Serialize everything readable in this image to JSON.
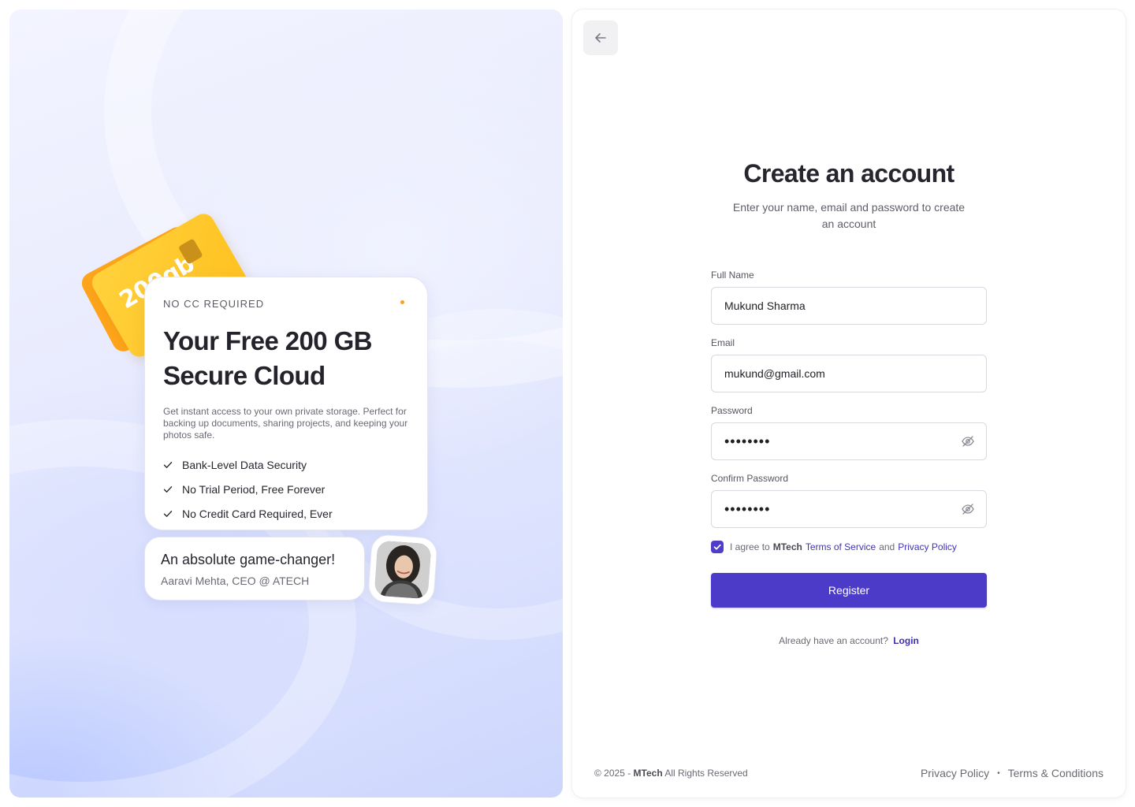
{
  "promo": {
    "storage_badge": "200gb",
    "eyebrow": "NO CC REQUIRED",
    "title_line1": "Your Free 200 GB",
    "title_line2": "Secure Cloud",
    "description": "Get instant access to your own private storage. Perfect for backing up documents, sharing projects, and keeping your photos safe.",
    "features": [
      {
        "label": "Bank-Level Data Security",
        "icon": "check-icon"
      },
      {
        "label": "No Trial Period, Free Forever",
        "icon": "check-icon"
      },
      {
        "label": "No Credit Card Required, Ever",
        "icon": "check-icon"
      }
    ],
    "accent_color": "#ffc01f",
    "dot_color": "#ff9f1a"
  },
  "testimonial": {
    "quote": "An absolute game-changer!",
    "author": "Aaravi Mehta, CEO @ ATECH"
  },
  "form": {
    "title": "Create an account",
    "subtitle": "Enter your name, email and password to create an account",
    "fields": {
      "full_name": {
        "label": "Full Name",
        "value": "Mukund Sharma"
      },
      "email": {
        "label": "Email",
        "value": "mukund@gmail.com"
      },
      "password": {
        "label": "Password",
        "value": "••••••••",
        "icon": "eye-off-icon"
      },
      "confirm_password": {
        "label": "Confirm Password",
        "value": "••••••••",
        "icon": "eye-off-icon"
      }
    },
    "agree": {
      "checked": true,
      "prefix": "I agree to",
      "brand": "MTech",
      "terms": "Terms of Service",
      "and": "and",
      "privacy": "Privacy Policy"
    },
    "register_label": "Register",
    "login_prompt": "Already have an account?",
    "login_link": "Login",
    "primary_color": "#4c3bc8"
  },
  "footer": {
    "copy_prefix": "© 2025 -",
    "brand": "MTech",
    "copy_suffix": "All Rights Reserved",
    "links": [
      "Privacy Policy",
      "Terms & Conditions"
    ],
    "separator": "•"
  },
  "nav": {
    "back_icon": "arrow-left-icon"
  }
}
